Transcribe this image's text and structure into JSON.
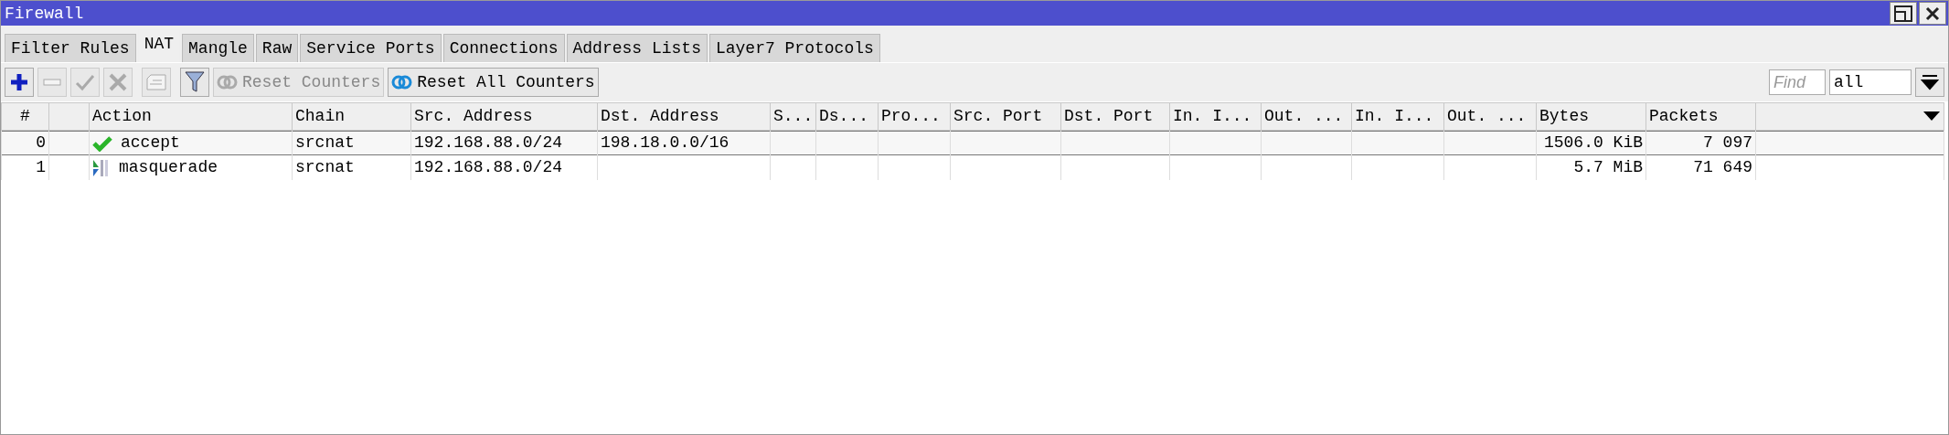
{
  "window": {
    "title": "Firewall"
  },
  "tabs": [
    {
      "label": "Filter Rules",
      "selected": false
    },
    {
      "label": "NAT",
      "selected": true
    },
    {
      "label": "Mangle",
      "selected": false
    },
    {
      "label": "Raw",
      "selected": false
    },
    {
      "label": "Service Ports",
      "selected": false
    },
    {
      "label": "Connections",
      "selected": false
    },
    {
      "label": "Address Lists",
      "selected": false
    },
    {
      "label": "Layer7 Protocols",
      "selected": false
    }
  ],
  "toolbar": [
    {
      "kind": "add",
      "disabled": false
    },
    {
      "kind": "remove",
      "disabled": true
    },
    {
      "kind": "enable",
      "disabled": true
    },
    {
      "kind": "disable",
      "disabled": true
    },
    {
      "kind": "comment",
      "disabled": true
    },
    {
      "kind": "filter",
      "disabled": false
    },
    {
      "kind": "reset",
      "label": "Reset Counters",
      "disabled": true
    },
    {
      "kind": "reset",
      "label": "Reset All Counters",
      "disabled": false
    }
  ],
  "find": {
    "placeholder": "Find",
    "value": "all"
  },
  "table": {
    "columns": [
      "#",
      "",
      "Action",
      "Chain",
      "Src. Address",
      "Dst. Address",
      "S...",
      "Ds...",
      "Pro...",
      "Src. Port",
      "Dst. Port",
      "In. I...",
      "Out. ...",
      "In. I...",
      "Out. ...",
      "Bytes",
      "Packets"
    ],
    "rows": [
      {
        "number": "0",
        "action": "accept",
        "kind": "accept",
        "chain": "srcnat",
        "src_address": "192.168.88.0/24",
        "dst_address": "198.18.0.0/16",
        "bytes": "1506.0 KiB",
        "packets": "7 097",
        "selected": true
      },
      {
        "number": "1",
        "action": "masquerade",
        "kind": "masquerade",
        "chain": "srcnat",
        "src_address": "192.168.88.0/24",
        "bytes": "5.7 MiB",
        "packets": "71 649",
        "selected": false
      }
    ]
  }
}
